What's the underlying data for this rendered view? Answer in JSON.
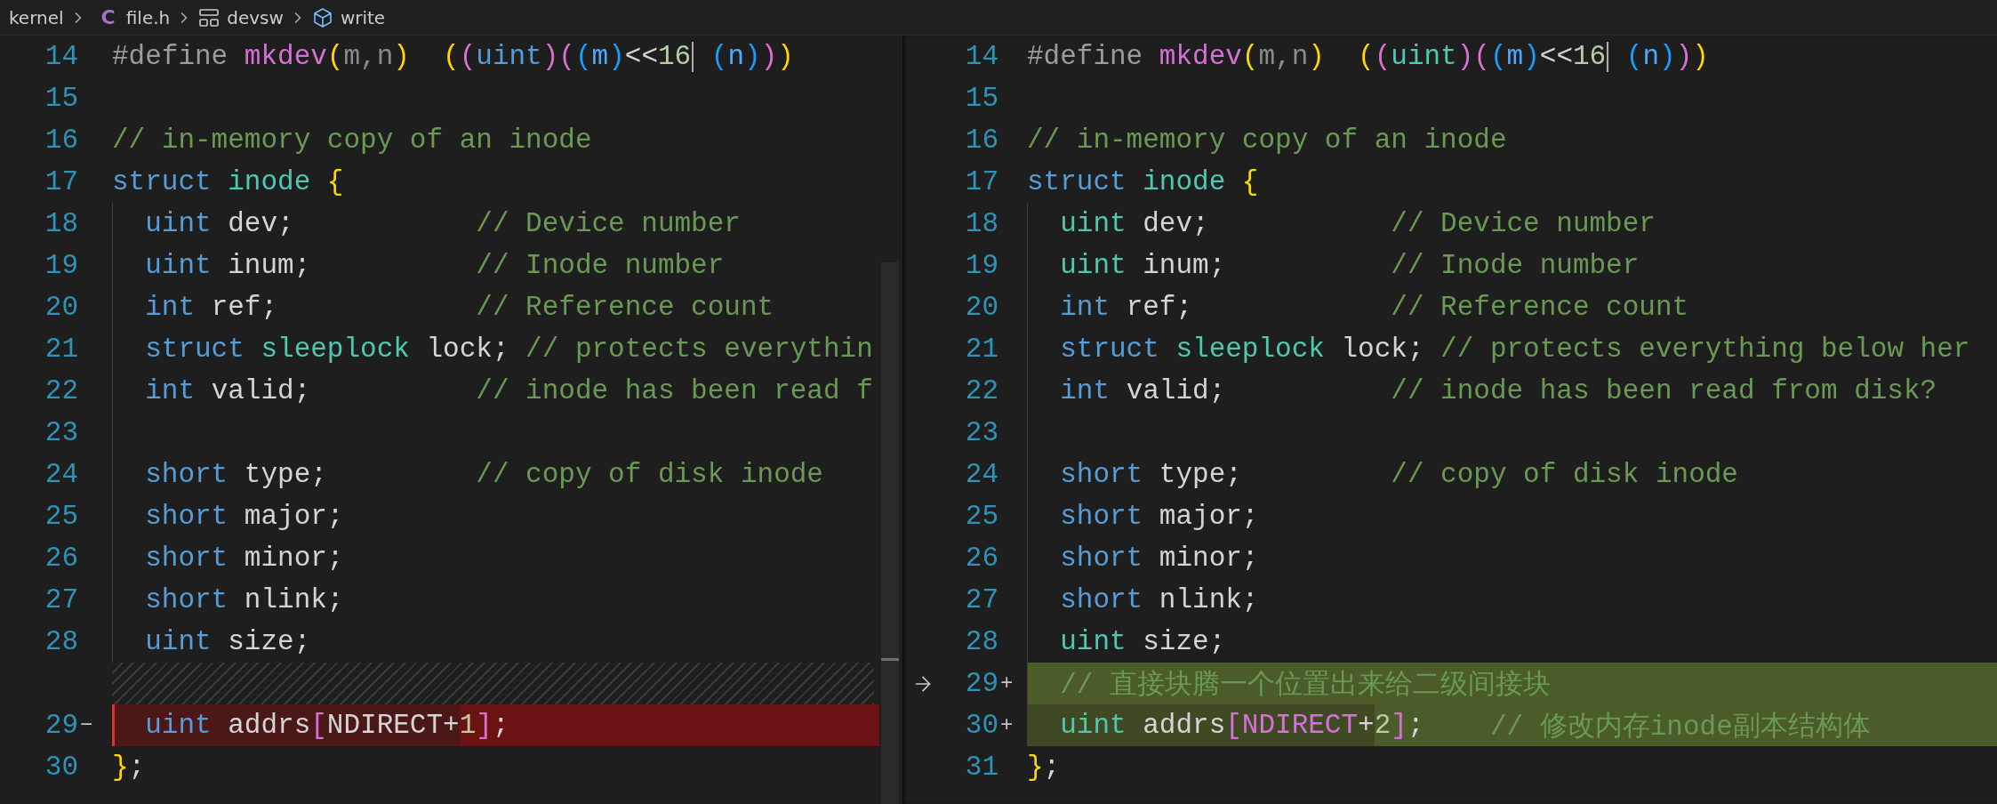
{
  "breadcrumb": [
    {
      "label": "kernel",
      "kind": "plain"
    },
    {
      "label": "file.h",
      "kind": "c-file",
      "icon_text": "C"
    },
    {
      "label": "devsw",
      "kind": "struct"
    },
    {
      "label": "write",
      "kind": "method"
    }
  ],
  "panes": [
    {
      "lines": [
        {
          "number": "14",
          "kind": "normal",
          "tokens": [
            {
              "t": "#define ",
              "kind": "macro"
            },
            {
              "t": "mkdev",
              "kind": "func"
            },
            {
              "t": "(",
              "kind": "b1"
            },
            {
              "t": "m",
              "kind": "param"
            },
            {
              "t": ",",
              "kind": "param"
            },
            {
              "t": "n",
              "kind": "param"
            },
            {
              "t": ")  ",
              "kind": "b1"
            },
            {
              "t": "(",
              "kind": "b1"
            },
            {
              "t": "(",
              "kind": "b2"
            },
            {
              "t": "uint",
              "kind": "keyword"
            },
            {
              "t": ")",
              "kind": "b2"
            },
            {
              "t": "(",
              "kind": "b2"
            },
            {
              "t": "(",
              "kind": "b3"
            },
            {
              "t": "m",
              "kind": "var"
            },
            {
              "t": ")",
              "kind": "b3"
            },
            {
              "t": "<<",
              "kind": "plain"
            },
            {
              "t": "16",
              "kind": "number"
            },
            {
              "kind": "cursor"
            },
            {
              "t": " (",
              "kind": "b3"
            },
            {
              "t": "n",
              "kind": "var"
            },
            {
              "t": ")",
              "kind": "b3"
            },
            {
              "t": ")",
              "kind": "b2"
            },
            {
              "t": ")",
              "kind": "b1"
            }
          ]
        },
        {
          "number": "15",
          "kind": "normal"
        },
        {
          "number": "16",
          "kind": "normal",
          "tokens": [
            {
              "t": "// in-memory copy of an inode",
              "kind": "comment"
            }
          ]
        },
        {
          "number": "17",
          "kind": "normal",
          "tokens": [
            {
              "t": "struct ",
              "kind": "keyword"
            },
            {
              "t": "inode ",
              "kind": "type"
            },
            {
              "t": "{",
              "kind": "b1"
            }
          ]
        },
        {
          "number": "18",
          "kind": "normal",
          "guide": true,
          "tokens": [
            {
              "t": "  uint ",
              "kind": "keyword"
            },
            {
              "t": "dev;           ",
              "kind": "plain"
            },
            {
              "t": "// Device number",
              "kind": "comment"
            }
          ]
        },
        {
          "number": "19",
          "kind": "normal",
          "guide": true,
          "tokens": [
            {
              "t": "  uint ",
              "kind": "keyword"
            },
            {
              "t": "inum;          ",
              "kind": "plain"
            },
            {
              "t": "// Inode number",
              "kind": "comment"
            }
          ]
        },
        {
          "number": "20",
          "kind": "normal",
          "guide": true,
          "tokens": [
            {
              "t": "  int ",
              "kind": "keyword"
            },
            {
              "t": "ref;            ",
              "kind": "plain"
            },
            {
              "t": "// Reference count",
              "kind": "comment"
            }
          ]
        },
        {
          "number": "21",
          "kind": "normal",
          "guide": true,
          "tokens": [
            {
              "t": "  struct ",
              "kind": "keyword"
            },
            {
              "t": "sleeplock ",
              "kind": "type"
            },
            {
              "t": "lock; ",
              "kind": "plain"
            },
            {
              "t": "// protects everythin",
              "kind": "comment"
            }
          ]
        },
        {
          "number": "22",
          "kind": "normal",
          "guide": true,
          "tokens": [
            {
              "t": "  int ",
              "kind": "keyword"
            },
            {
              "t": "valid;          ",
              "kind": "plain"
            },
            {
              "t": "// inode has been read f",
              "kind": "comment"
            }
          ]
        },
        {
          "number": "23",
          "kind": "normal",
          "guide": true
        },
        {
          "number": "24",
          "kind": "normal",
          "guide": true,
          "tokens": [
            {
              "t": "  short ",
              "kind": "keyword"
            },
            {
              "t": "type;         ",
              "kind": "plain"
            },
            {
              "t": "// copy of disk inode",
              "kind": "comment"
            }
          ]
        },
        {
          "number": "25",
          "kind": "normal",
          "guide": true,
          "tokens": [
            {
              "t": "  short ",
              "kind": "keyword"
            },
            {
              "t": "major;",
              "kind": "plain"
            }
          ]
        },
        {
          "number": "26",
          "kind": "normal",
          "guide": true,
          "tokens": [
            {
              "t": "  short ",
              "kind": "keyword"
            },
            {
              "t": "minor;",
              "kind": "plain"
            }
          ]
        },
        {
          "number": "27",
          "kind": "normal",
          "guide": true,
          "tokens": [
            {
              "t": "  short ",
              "kind": "keyword"
            },
            {
              "t": "nlink;",
              "kind": "plain"
            }
          ]
        },
        {
          "number": "28",
          "kind": "normal",
          "guide": true,
          "tokens": [
            {
              "t": "  uint ",
              "kind": "keyword"
            },
            {
              "t": "size;",
              "kind": "plain"
            }
          ]
        },
        {
          "kind": "filler"
        },
        {
          "number": "29",
          "marker": "−",
          "kind": "removed",
          "tokens": [
            {
              "t": "  uint ",
              "kind": "keyword"
            },
            {
              "t": "addrs",
              "kind": "plain"
            },
            {
              "t": "[",
              "kind": "b2"
            },
            {
              "t": "NDIRECT+",
              "kind": "plain"
            }
          ],
          "changed_tokens": [
            {
              "t": "1",
              "kind": "number"
            },
            {
              "t": "]",
              "kind": "b2"
            },
            {
              "t": ";",
              "kind": "plain"
            }
          ]
        },
        {
          "number": "30",
          "kind": "normal",
          "tokens": [
            {
              "t": "}",
              "kind": "b1"
            },
            {
              "t": ";",
              "kind": "plain"
            }
          ]
        }
      ]
    },
    {
      "lines": [
        {
          "number": "14",
          "kind": "normal",
          "tokens": [
            {
              "t": "#define ",
              "kind": "macro"
            },
            {
              "t": "mkdev",
              "kind": "func"
            },
            {
              "t": "(",
              "kind": "b1"
            },
            {
              "t": "m",
              "kind": "param"
            },
            {
              "t": ",",
              "kind": "param"
            },
            {
              "t": "n",
              "kind": "param"
            },
            {
              "t": ")  ",
              "kind": "b1"
            },
            {
              "t": "(",
              "kind": "b1"
            },
            {
              "t": "(",
              "kind": "b2"
            },
            {
              "t": "uint",
              "kind": "type"
            },
            {
              "t": ")",
              "kind": "b2"
            },
            {
              "t": "(",
              "kind": "b2"
            },
            {
              "t": "(",
              "kind": "b3"
            },
            {
              "t": "m",
              "kind": "var"
            },
            {
              "t": ")",
              "kind": "b3"
            },
            {
              "t": "<<",
              "kind": "plain"
            },
            {
              "t": "16",
              "kind": "number"
            },
            {
              "kind": "cursor"
            },
            {
              "t": " (",
              "kind": "b3"
            },
            {
              "t": "n",
              "kind": "var"
            },
            {
              "t": ")",
              "kind": "b3"
            },
            {
              "t": ")",
              "kind": "b2"
            },
            {
              "t": ")",
              "kind": "b1"
            }
          ]
        },
        {
          "number": "15",
          "kind": "normal"
        },
        {
          "number": "16",
          "kind": "normal",
          "tokens": [
            {
              "t": "// in-memory copy of an inode",
              "kind": "comment"
            }
          ]
        },
        {
          "number": "17",
          "kind": "normal",
          "tokens": [
            {
              "t": "struct ",
              "kind": "keyword"
            },
            {
              "t": "inode ",
              "kind": "type"
            },
            {
              "t": "{",
              "kind": "b1"
            }
          ]
        },
        {
          "number": "18",
          "kind": "normal",
          "guide": true,
          "tokens": [
            {
              "t": "  uint ",
              "kind": "type"
            },
            {
              "t": "dev;           ",
              "kind": "plain"
            },
            {
              "t": "// Device number",
              "kind": "comment"
            }
          ]
        },
        {
          "number": "19",
          "kind": "normal",
          "guide": true,
          "tokens": [
            {
              "t": "  uint ",
              "kind": "type"
            },
            {
              "t": "inum;          ",
              "kind": "plain"
            },
            {
              "t": "// Inode number",
              "kind": "comment"
            }
          ]
        },
        {
          "number": "20",
          "kind": "normal",
          "guide": true,
          "tokens": [
            {
              "t": "  int ",
              "kind": "keyword"
            },
            {
              "t": "ref;            ",
              "kind": "plain"
            },
            {
              "t": "// Reference count",
              "kind": "comment"
            }
          ]
        },
        {
          "number": "21",
          "kind": "normal",
          "guide": true,
          "tokens": [
            {
              "t": "  struct ",
              "kind": "keyword"
            },
            {
              "t": "sleeplock ",
              "kind": "type"
            },
            {
              "t": "lock; ",
              "kind": "plain"
            },
            {
              "t": "// protects everything below her",
              "kind": "comment"
            }
          ]
        },
        {
          "number": "22",
          "kind": "normal",
          "guide": true,
          "tokens": [
            {
              "t": "  int ",
              "kind": "keyword"
            },
            {
              "t": "valid;          ",
              "kind": "plain"
            },
            {
              "t": "// inode has been read from disk?",
              "kind": "comment"
            }
          ]
        },
        {
          "number": "23",
          "kind": "normal",
          "guide": true
        },
        {
          "number": "24",
          "kind": "normal",
          "guide": true,
          "tokens": [
            {
              "t": "  short ",
              "kind": "keyword"
            },
            {
              "t": "type;         ",
              "kind": "plain"
            },
            {
              "t": "// copy of disk inode",
              "kind": "comment"
            }
          ]
        },
        {
          "number": "25",
          "kind": "normal",
          "guide": true,
          "tokens": [
            {
              "t": "  short ",
              "kind": "keyword"
            },
            {
              "t": "major;",
              "kind": "plain"
            }
          ]
        },
        {
          "number": "26",
          "kind": "normal",
          "guide": true,
          "tokens": [
            {
              "t": "  short ",
              "kind": "keyword"
            },
            {
              "t": "minor;",
              "kind": "plain"
            }
          ]
        },
        {
          "number": "27",
          "kind": "normal",
          "guide": true,
          "tokens": [
            {
              "t": "  short ",
              "kind": "keyword"
            },
            {
              "t": "nlink;",
              "kind": "plain"
            }
          ]
        },
        {
          "number": "28",
          "kind": "normal",
          "guide": true,
          "tokens": [
            {
              "t": "  uint ",
              "kind": "type"
            },
            {
              "t": "size;",
              "kind": "plain"
            }
          ]
        },
        {
          "number": "29",
          "marker": "+",
          "kind": "added",
          "guide": true,
          "arrow": true,
          "changed_tokens": [
            {
              "t": "  // 直接块腾一个位置出来给二级间接块",
              "kind": "comment"
            }
          ]
        },
        {
          "number": "30",
          "marker": "+",
          "kind": "added",
          "guide": true,
          "tokens": [
            {
              "t": "  uint ",
              "kind": "type"
            },
            {
              "t": "addrs",
              "kind": "plain"
            },
            {
              "t": "[",
              "kind": "b2"
            },
            {
              "t": "NDIRECT",
              "kind": "func"
            },
            {
              "t": "+",
              "kind": "plain"
            }
          ],
          "changed_tokens": [
            {
              "t": "2",
              "kind": "number"
            },
            {
              "t": "]",
              "kind": "b2"
            },
            {
              "t": ";    ",
              "kind": "plain"
            },
            {
              "t": "// 修改内存inode副本结构体",
              "kind": "comment"
            }
          ]
        },
        {
          "number": "31",
          "kind": "normal",
          "tokens": [
            {
              "t": "}",
              "kind": "b1"
            },
            {
              "t": ";",
              "kind": "plain"
            }
          ]
        }
      ]
    }
  ]
}
